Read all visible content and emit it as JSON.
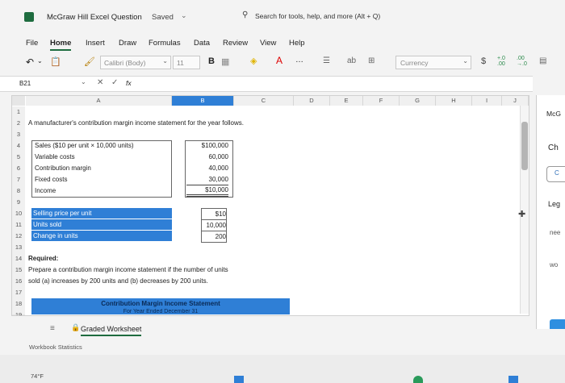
{
  "titlebar": {
    "title": "McGraw Hill Excel Question",
    "status": "Saved",
    "search_placeholder": "Search for tools, help, and more (Alt + Q)"
  },
  "menu": [
    "File",
    "Home",
    "Insert",
    "Draw",
    "Formulas",
    "Data",
    "Review",
    "View",
    "Help"
  ],
  "ribbon": {
    "font_name": "Calibri (Body)",
    "font_size": "11",
    "bold": "B",
    "number_format": "Currency",
    "currency_symbol": "$",
    "dec_inc": "+.0 .00",
    "dec_dec": ".00 →.0"
  },
  "formula_bar": {
    "name_box": "B21",
    "fx": "fx"
  },
  "columns": [
    "A",
    "B",
    "C",
    "D",
    "E",
    "F",
    "G",
    "H",
    "I",
    "J"
  ],
  "rows": [
    "1",
    "2",
    "3",
    "4",
    "5",
    "6",
    "7",
    "8",
    "9",
    "10",
    "11",
    "12",
    "13",
    "14",
    "15",
    "16",
    "17",
    "18",
    "19"
  ],
  "sheet": {
    "heading": "A manufacturer's contribution margin income statement for the year follows.",
    "statement": [
      {
        "label": "Sales ($10 per unit × 10,000 units)",
        "value": "$100,000"
      },
      {
        "label": "Variable costs",
        "value": "60,000"
      },
      {
        "label": "Contribution margin",
        "value": "40,000"
      },
      {
        "label": "Fixed costs",
        "value": "30,000"
      },
      {
        "label": "Income",
        "value": "$10,000"
      }
    ],
    "inputs": [
      {
        "label": "Selling price per unit",
        "value": "$10"
      },
      {
        "label": "Units sold",
        "value": "10,000"
      },
      {
        "label": "Change in units",
        "value": "200"
      }
    ],
    "required_label": "Required:",
    "required_text_1": "Prepare a contribution margin income statement if the number of units",
    "required_text_2": "sold (a) increases by 200 units and (b) decreases by 200 units.",
    "cmis_header": "Contribution Margin Income Statement",
    "cmis_sub": "For Year Ended December 31"
  },
  "tabs": {
    "active_tab": "Graded Worksheet"
  },
  "statusbar": {
    "left": "Workbook Statistics"
  },
  "side_panel": [
    "McG",
    "Ch",
    "C",
    "Leg",
    "nee",
    "wo"
  ],
  "taskbar": {
    "weather": "74°F"
  },
  "colors": {
    "accent": "#2f7fd6",
    "cmis_fill": "#2f7fd6"
  }
}
